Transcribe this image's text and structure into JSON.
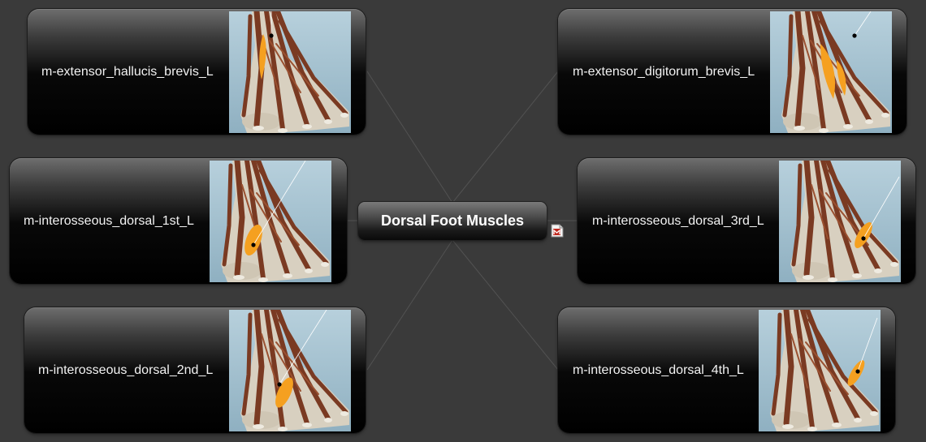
{
  "central_topic": "Dorsal Foot Muscles",
  "topics": [
    {
      "id": "ehb",
      "label": "m-extensor_hallucis_brevis_L"
    },
    {
      "id": "edb",
      "label": "m-extensor_digitorum_brevis_L"
    },
    {
      "id": "id1",
      "label": "m-interosseous_dorsal_1st_L"
    },
    {
      "id": "id3",
      "label": "m-interosseous_dorsal_3rd_L"
    },
    {
      "id": "id2",
      "label": "m-interosseous_dorsal_2nd_L"
    },
    {
      "id": "id4",
      "label": "m-interosseous_dorsal_4th_L"
    }
  ],
  "colors": {
    "background": "#3a3a3a",
    "node_text": "#f2f2f2",
    "thumb_background": "#9fbccb",
    "bone": "#d8d0c0",
    "muscle": "#7a3a22",
    "highlight": "#f5a020",
    "connector": "#525252",
    "attachment_icon": "#c0281e"
  },
  "icons": {
    "attachment": "document-attachment-icon"
  }
}
